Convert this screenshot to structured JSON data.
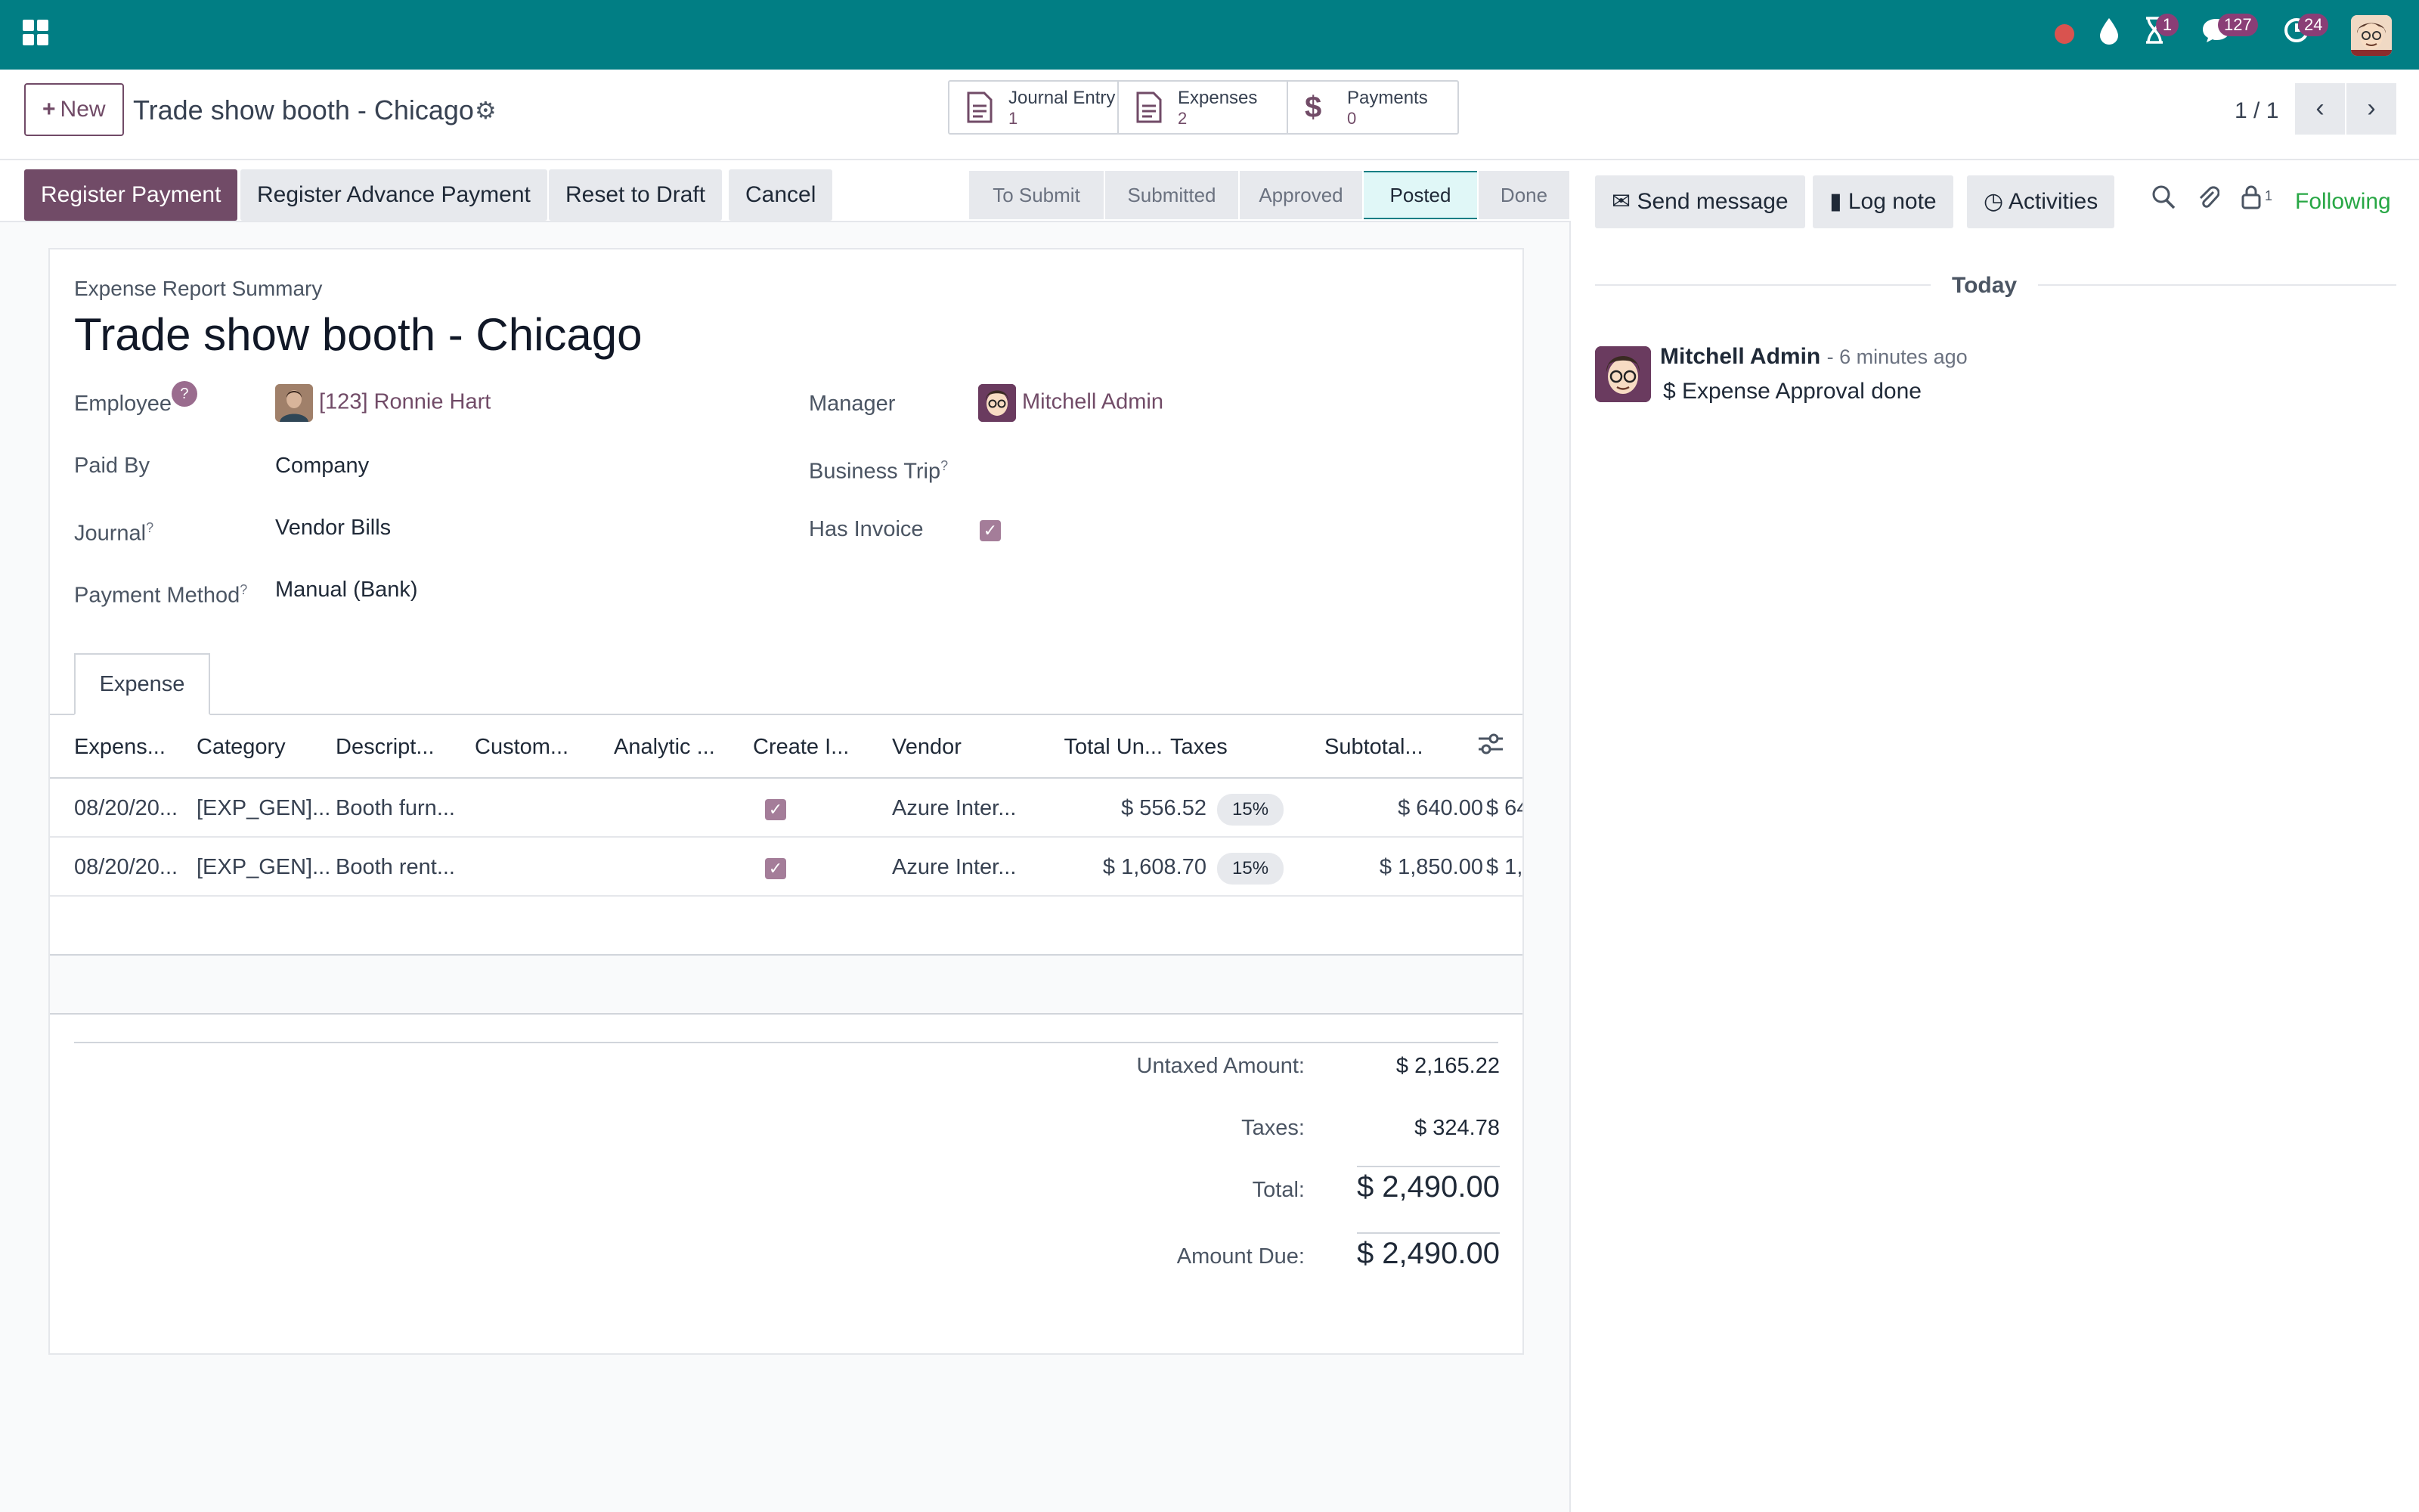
{
  "topbar": {
    "activity_badge": "1",
    "messages_badge": "127",
    "updates_badge": "24"
  },
  "control_panel": {
    "new_label": "New",
    "record_title": "Trade show booth - Chicago",
    "smart_buttons": [
      {
        "label": "Journal Entry",
        "count": "1"
      },
      {
        "label": "Expenses",
        "count": "2"
      },
      {
        "label": "Payments",
        "count": "0"
      }
    ],
    "pager": "1 / 1"
  },
  "actions": {
    "register_payment": "Register Payment",
    "register_advance": "Register Advance Payment",
    "reset_draft": "Reset to Draft",
    "cancel": "Cancel"
  },
  "stages": [
    "To Submit",
    "Submitted",
    "Approved",
    "Posted",
    "Done"
  ],
  "stage_current": "Posted",
  "sheet": {
    "subtitle": "Expense Report Summary",
    "title": "Trade show booth - Chicago",
    "fields": {
      "employee_label": "Employee",
      "employee_value": "[123] Ronnie Hart",
      "manager_label": "Manager",
      "manager_value": "Mitchell Admin",
      "paid_by_label": "Paid By",
      "paid_by_value": "Company",
      "business_trip_label": "Business Trip",
      "journal_label": "Journal",
      "journal_value": "Vendor Bills",
      "has_invoice_label": "Has Invoice",
      "payment_method_label": "Payment Method",
      "payment_method_value": "Manual (Bank)",
      "help_mark": "?"
    },
    "tab_label": "Expense",
    "table": {
      "headers": [
        "Expens...",
        "Category",
        "Descript...",
        "Custom...",
        "Analytic ...",
        "Create I...",
        "Vendor",
        "Total Un...",
        "Taxes",
        "Subtotal..."
      ],
      "rows": [
        {
          "date": "08/20/20...",
          "category": "[EXP_GEN]...",
          "description": "Booth furn...",
          "vendor": "Azure Inter...",
          "unit": "$ 556.52",
          "tax": "15%",
          "subtotal": "$ 640.00",
          "total": "$ 64"
        },
        {
          "date": "08/20/20...",
          "category": "[EXP_GEN]...",
          "description": "Booth rent...",
          "vendor": "Azure Inter...",
          "unit": "$ 1,608.70",
          "tax": "15%",
          "subtotal": "$ 1,850.00",
          "total": "$ 1,8"
        }
      ]
    },
    "totals": {
      "untaxed_label": "Untaxed Amount:",
      "untaxed_value": "$ 2,165.22",
      "taxes_label": "Taxes:",
      "taxes_value": "$ 324.78",
      "total_label": "Total:",
      "total_value": "$ 2,490.00",
      "due_label": "Amount Due:",
      "due_value": "$ 2,490.00"
    }
  },
  "chatter": {
    "send_message": "Send message",
    "log_note": "Log note",
    "activities": "Activities",
    "followers_count": "1",
    "following": "Following",
    "today": "Today",
    "message": {
      "author": "Mitchell Admin",
      "time": "- 6 minutes ago",
      "body": "Expense Approval done"
    }
  },
  "colors": {
    "topbar": "#017e84",
    "primary": "#714b67",
    "following": "#28a745"
  }
}
